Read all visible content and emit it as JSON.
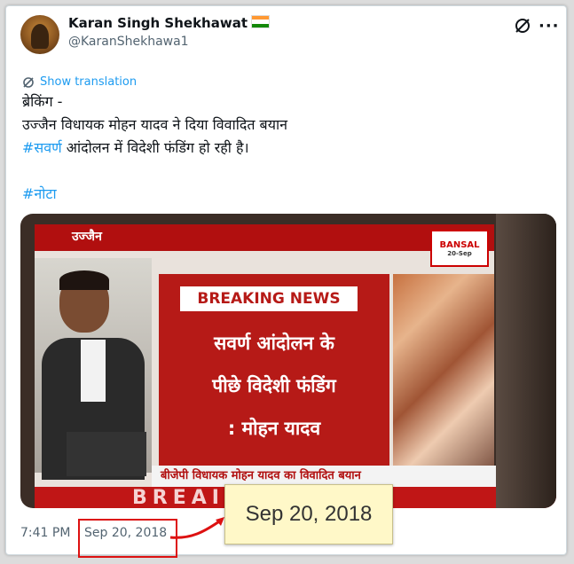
{
  "author": {
    "name": "Karan Singh Shekhawat",
    "handle": "@KaranShekhawa1"
  },
  "icons": {
    "flag": "india-flag-icon",
    "grok": "grok-icon",
    "more": "more-options-icon",
    "translate": "translate-icon"
  },
  "translate_label": "Show translation",
  "tweet": {
    "line1": "ब्रेकिंग -",
    "line2": "उज्जैन विधायक मोहन यादव ने दिया विवादित बयान",
    "line3_tag": "#सवर्ण",
    "line3_rest": " आंदोलन में विदेशी फंडिंग हो रही है।",
    "tag2": "#नोटा"
  },
  "media": {
    "city": "उज्जैन",
    "logo": "BANSAL",
    "logo_date": "20-Sep",
    "breaking": "BREAKING NEWS",
    "headline1": "सवर्ण आंदोलन के",
    "headline2": "पीछे विदेशी फंडिंग",
    "headline3": ": मोहन यादव",
    "ticker": "बीजेपी विधायक मोहन यादव का विवादित बयान",
    "bottom": "BREAI"
  },
  "meta": {
    "time": "7:41 PM",
    "date": "Sep 20, 2018"
  },
  "callout": "Sep 20, 2018",
  "colors": {
    "link": "#1d9bf0",
    "highlight_red": "#d11",
    "callout_bg": "#fff8c8"
  }
}
